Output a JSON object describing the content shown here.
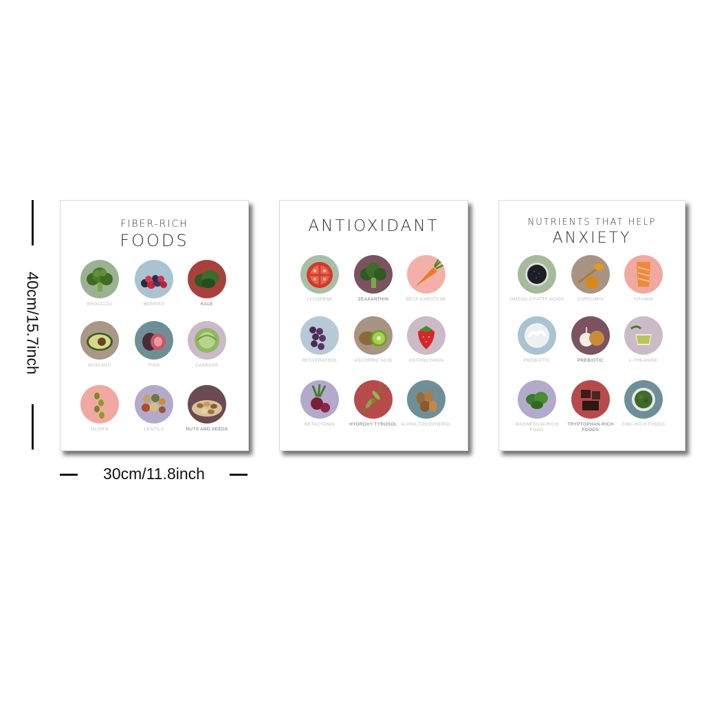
{
  "dimensions": {
    "height_label": "40cm/15.7inch",
    "width_label": "30cm/11.8inch"
  },
  "posters": {
    "fiber": {
      "title_small": "FIBER-RICH",
      "title_big": "FOODS",
      "items": [
        {
          "label": "BROCCOLI",
          "icon": "broccoli-icon",
          "bg": "#9bb292"
        },
        {
          "label": "BERRIES",
          "icon": "berries-icon",
          "bg": "#a9c3d1"
        },
        {
          "label": "KALE",
          "icon": "kale-icon",
          "bg": "#a8403e"
        },
        {
          "label": "AVOCADO",
          "icon": "avocado-icon",
          "bg": "#a99886"
        },
        {
          "label": "FIGS",
          "icon": "fig-icon",
          "bg": "#a6bfc8"
        },
        {
          "label": "CABBAGE",
          "icon": "cabbage-icon",
          "bg": "#cdb9c9"
        },
        {
          "label": "OLIVES",
          "icon": "olive-icon",
          "bg": "#f1a8a1"
        },
        {
          "label": "LENTILS",
          "icon": "lentils-icon",
          "bg": "#b3aacb"
        },
        {
          "label": "NUTS AND SEEDS",
          "icon": "nuts-icon",
          "bg": "#6b4a52"
        }
      ]
    },
    "antioxidant": {
      "title_big": "ANTIOXIDANT",
      "items": [
        {
          "label": "LYCOPENE",
          "icon": "tomato-icon",
          "bg": "#a6bfa6"
        },
        {
          "label": "ZEAXANTHIN",
          "icon": "broccoli-icon",
          "bg": "#7a5260"
        },
        {
          "label": "BETA CAROTENE",
          "icon": "carrot-icon",
          "bg": "#f4b0a8"
        },
        {
          "label": "RESVERATROL",
          "icon": "grape-icon",
          "bg": "#b7c9d6"
        },
        {
          "label": "ASCORBIC ACID",
          "icon": "kiwi-icon",
          "bg": "#a99383"
        },
        {
          "label": "ANTHOCYANIN",
          "icon": "strawberry-icon",
          "bg": "#cbbac8"
        },
        {
          "label": "BETACYANIN",
          "icon": "beet-icon",
          "bg": "#b3aacb"
        },
        {
          "label": "HYDROXY TYROSOL",
          "icon": "olive-branch-icon",
          "bg": "#b74b4b"
        },
        {
          "label": "ALPHA TOCOPHEROL",
          "icon": "almond-icon",
          "bg": "#6f8f97"
        }
      ]
    },
    "anxiety": {
      "title_small": "NUTRIENTS THAT HELP",
      "title_big": "ANXIETY",
      "items": [
        {
          "label": "OMEGA-3 FATTY ACIDS",
          "icon": "chia-seeds-icon",
          "bg": "#a6bb9c"
        },
        {
          "label": "CURCUMIN",
          "icon": "turmeric-icon",
          "bg": "#a99383"
        },
        {
          "label": "VITAMIN",
          "icon": "salmon-icon",
          "bg": "#f1a8a1"
        },
        {
          "label": "PROBIOTIC",
          "icon": "yogurt-icon",
          "bg": "#a9c3d1"
        },
        {
          "label": "PREBIOTIC",
          "icon": "garlic-onion-icon",
          "bg": "#7a5260"
        },
        {
          "label": "L-THEANINE",
          "icon": "green-tea-icon",
          "bg": "#cbbac8"
        },
        {
          "label": "MAGNESIUM-RICH FOOD",
          "icon": "spinach-icon",
          "bg": "#b3aacb"
        },
        {
          "label": "TRYPTOPHAN-RICH FOODS",
          "icon": "chocolate-icon",
          "bg": "#b74b4b"
        },
        {
          "label": "ZINC-RICH FOODS",
          "icon": "seaweed-icon",
          "bg": "#6f8f97"
        }
      ]
    }
  }
}
